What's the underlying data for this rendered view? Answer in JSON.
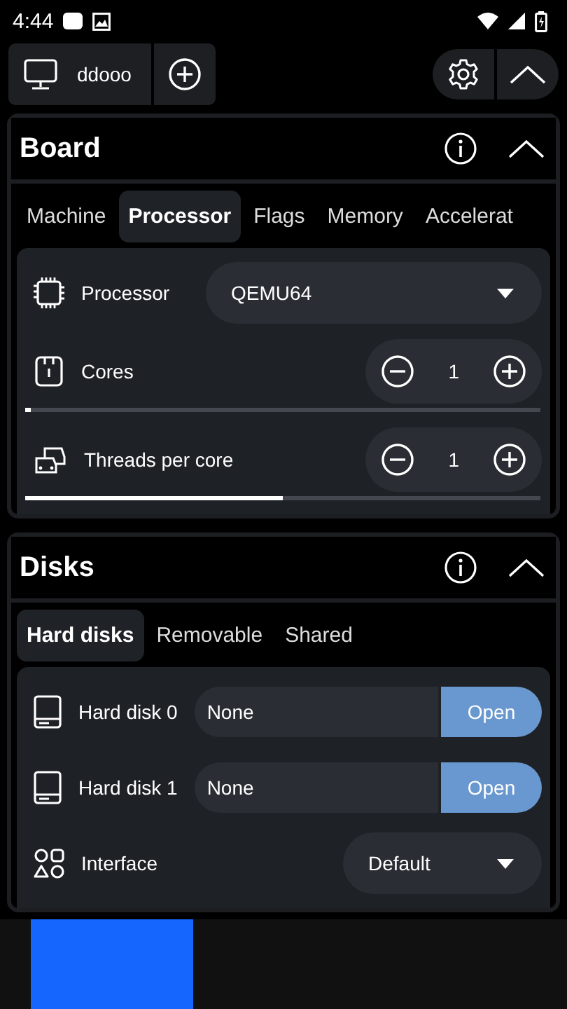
{
  "status_bar": {
    "time": "4:44"
  },
  "toolbar": {
    "machine": "ddooo"
  },
  "sections": [
    {
      "title": "Board",
      "expanded": true,
      "tabs": [
        {
          "label": "Machine",
          "selected": false
        },
        {
          "label": "Processor",
          "selected": true
        },
        {
          "label": "Flags",
          "selected": false
        },
        {
          "label": "Memory",
          "selected": false
        },
        {
          "label": "Accelerat",
          "selected": false
        }
      ],
      "rows": [
        {
          "kind": "dropdown",
          "label": "Processor",
          "value": "QEMU64",
          "wide": true
        },
        {
          "kind": "stepper",
          "label": "Cores",
          "value": "1",
          "level": 0.01
        },
        {
          "kind": "stepper",
          "label": "Threads per core",
          "value": "1",
          "level": 0.5
        }
      ]
    },
    {
      "title": "Disks",
      "expanded": true,
      "tabs": [
        {
          "label": "Hard disks",
          "selected": true
        },
        {
          "label": "Removable",
          "selected": false
        },
        {
          "label": "Shared",
          "selected": false
        }
      ],
      "rows": [
        {
          "kind": "file",
          "label": "Hard disk 0",
          "value": "None",
          "button": "Open"
        },
        {
          "kind": "file",
          "label": "Hard disk 1",
          "value": "None",
          "button": "Open"
        },
        {
          "kind": "dropdown",
          "label": "Interface",
          "value": "Default",
          "wide": false
        }
      ]
    }
  ]
}
